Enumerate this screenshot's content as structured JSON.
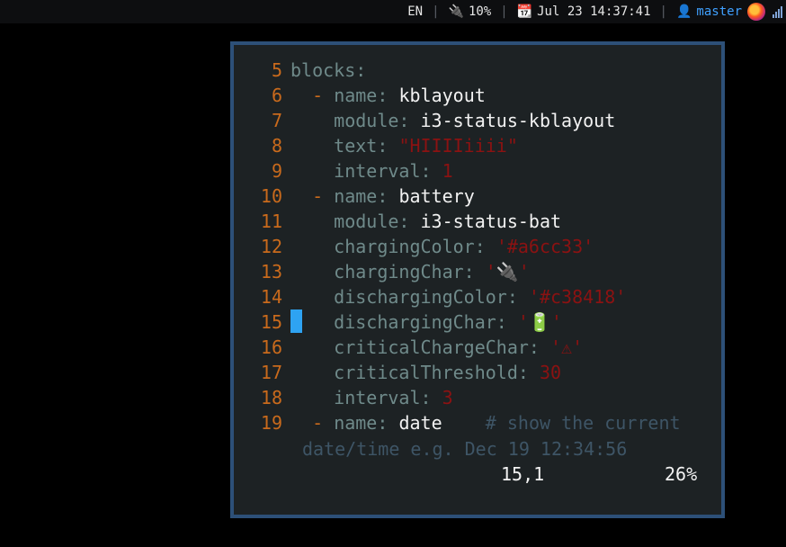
{
  "topbar": {
    "language": "EN",
    "battery_icon": "plug-icon",
    "battery": "10%",
    "calendar_icon": "calendar-icon",
    "datetime": "Jul 23 14:37:41",
    "user_icon": "user-icon",
    "user": "master",
    "separator": "|"
  },
  "editor": {
    "lines": [
      {
        "num": "5",
        "indent": "",
        "dash": "",
        "key": "blocks",
        "value": "",
        "value_type": ""
      },
      {
        "num": "6",
        "indent": "  ",
        "dash": "- ",
        "key": "name",
        "value": "kblayout",
        "value_type": "val"
      },
      {
        "num": "7",
        "indent": "    ",
        "dash": "",
        "key": "module",
        "value": "i3-status-kblayout",
        "value_type": "val"
      },
      {
        "num": "8",
        "indent": "    ",
        "dash": "",
        "key": "text",
        "value": "\"HIIIIiiii\"",
        "value_type": "str"
      },
      {
        "num": "9",
        "indent": "    ",
        "dash": "",
        "key": "interval",
        "value": "1",
        "value_type": "num"
      },
      {
        "num": "10",
        "indent": "  ",
        "dash": "- ",
        "key": "name",
        "value": "battery",
        "value_type": "val"
      },
      {
        "num": "11",
        "indent": "    ",
        "dash": "",
        "key": "module",
        "value": "i3-status-bat",
        "value_type": "val"
      },
      {
        "num": "12",
        "indent": "    ",
        "dash": "",
        "key": "chargingColor",
        "value": "'#a6cc33'",
        "value_type": "str"
      },
      {
        "num": "13",
        "indent": "    ",
        "dash": "",
        "key": "chargingChar",
        "value": "'🔌'",
        "value_type": "str"
      },
      {
        "num": "14",
        "indent": "    ",
        "dash": "",
        "key": "dischargingColor",
        "value": "'#c38418'",
        "value_type": "str"
      },
      {
        "num": "15",
        "indent": "    ",
        "dash": "",
        "key": "dischargingChar",
        "value": "'🔋'",
        "value_type": "str"
      },
      {
        "num": "16",
        "indent": "    ",
        "dash": "",
        "key": "criticalChargeChar",
        "value": "'⚠'",
        "value_type": "str"
      },
      {
        "num": "17",
        "indent": "    ",
        "dash": "",
        "key": "criticalThreshold",
        "value": "30",
        "value_type": "num"
      },
      {
        "num": "18",
        "indent": "    ",
        "dash": "",
        "key": "interval",
        "value": "3",
        "value_type": "num"
      },
      {
        "num": "19",
        "indent": "  ",
        "dash": "- ",
        "key": "name",
        "value": "date",
        "value_type": "val",
        "comment": "    # show the current"
      }
    ],
    "wrapped_comment": "date/time e.g. Dec 19 12:34:56",
    "cursor_position": "15,1",
    "scroll_percent": "26%"
  }
}
